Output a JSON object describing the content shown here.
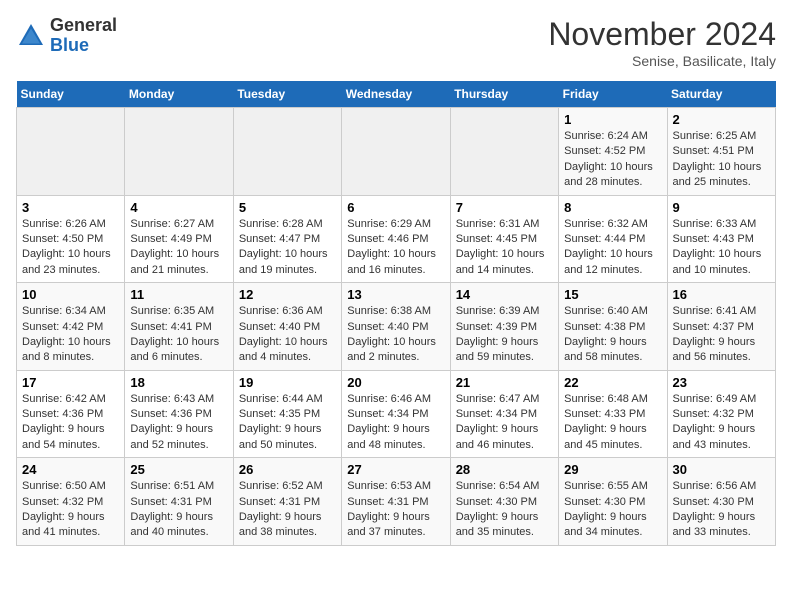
{
  "header": {
    "logo_general": "General",
    "logo_blue": "Blue",
    "month_title": "November 2024",
    "subtitle": "Senise, Basilicate, Italy"
  },
  "weekdays": [
    "Sunday",
    "Monday",
    "Tuesday",
    "Wednesday",
    "Thursday",
    "Friday",
    "Saturday"
  ],
  "weeks": [
    [
      {
        "day": "",
        "info": ""
      },
      {
        "day": "",
        "info": ""
      },
      {
        "day": "",
        "info": ""
      },
      {
        "day": "",
        "info": ""
      },
      {
        "day": "",
        "info": ""
      },
      {
        "day": "1",
        "info": "Sunrise: 6:24 AM\nSunset: 4:52 PM\nDaylight: 10 hours and 28 minutes."
      },
      {
        "day": "2",
        "info": "Sunrise: 6:25 AM\nSunset: 4:51 PM\nDaylight: 10 hours and 25 minutes."
      }
    ],
    [
      {
        "day": "3",
        "info": "Sunrise: 6:26 AM\nSunset: 4:50 PM\nDaylight: 10 hours and 23 minutes."
      },
      {
        "day": "4",
        "info": "Sunrise: 6:27 AM\nSunset: 4:49 PM\nDaylight: 10 hours and 21 minutes."
      },
      {
        "day": "5",
        "info": "Sunrise: 6:28 AM\nSunset: 4:47 PM\nDaylight: 10 hours and 19 minutes."
      },
      {
        "day": "6",
        "info": "Sunrise: 6:29 AM\nSunset: 4:46 PM\nDaylight: 10 hours and 16 minutes."
      },
      {
        "day": "7",
        "info": "Sunrise: 6:31 AM\nSunset: 4:45 PM\nDaylight: 10 hours and 14 minutes."
      },
      {
        "day": "8",
        "info": "Sunrise: 6:32 AM\nSunset: 4:44 PM\nDaylight: 10 hours and 12 minutes."
      },
      {
        "day": "9",
        "info": "Sunrise: 6:33 AM\nSunset: 4:43 PM\nDaylight: 10 hours and 10 minutes."
      }
    ],
    [
      {
        "day": "10",
        "info": "Sunrise: 6:34 AM\nSunset: 4:42 PM\nDaylight: 10 hours and 8 minutes."
      },
      {
        "day": "11",
        "info": "Sunrise: 6:35 AM\nSunset: 4:41 PM\nDaylight: 10 hours and 6 minutes."
      },
      {
        "day": "12",
        "info": "Sunrise: 6:36 AM\nSunset: 4:40 PM\nDaylight: 10 hours and 4 minutes."
      },
      {
        "day": "13",
        "info": "Sunrise: 6:38 AM\nSunset: 4:40 PM\nDaylight: 10 hours and 2 minutes."
      },
      {
        "day": "14",
        "info": "Sunrise: 6:39 AM\nSunset: 4:39 PM\nDaylight: 9 hours and 59 minutes."
      },
      {
        "day": "15",
        "info": "Sunrise: 6:40 AM\nSunset: 4:38 PM\nDaylight: 9 hours and 58 minutes."
      },
      {
        "day": "16",
        "info": "Sunrise: 6:41 AM\nSunset: 4:37 PM\nDaylight: 9 hours and 56 minutes."
      }
    ],
    [
      {
        "day": "17",
        "info": "Sunrise: 6:42 AM\nSunset: 4:36 PM\nDaylight: 9 hours and 54 minutes."
      },
      {
        "day": "18",
        "info": "Sunrise: 6:43 AM\nSunset: 4:36 PM\nDaylight: 9 hours and 52 minutes."
      },
      {
        "day": "19",
        "info": "Sunrise: 6:44 AM\nSunset: 4:35 PM\nDaylight: 9 hours and 50 minutes."
      },
      {
        "day": "20",
        "info": "Sunrise: 6:46 AM\nSunset: 4:34 PM\nDaylight: 9 hours and 48 minutes."
      },
      {
        "day": "21",
        "info": "Sunrise: 6:47 AM\nSunset: 4:34 PM\nDaylight: 9 hours and 46 minutes."
      },
      {
        "day": "22",
        "info": "Sunrise: 6:48 AM\nSunset: 4:33 PM\nDaylight: 9 hours and 45 minutes."
      },
      {
        "day": "23",
        "info": "Sunrise: 6:49 AM\nSunset: 4:32 PM\nDaylight: 9 hours and 43 minutes."
      }
    ],
    [
      {
        "day": "24",
        "info": "Sunrise: 6:50 AM\nSunset: 4:32 PM\nDaylight: 9 hours and 41 minutes."
      },
      {
        "day": "25",
        "info": "Sunrise: 6:51 AM\nSunset: 4:31 PM\nDaylight: 9 hours and 40 minutes."
      },
      {
        "day": "26",
        "info": "Sunrise: 6:52 AM\nSunset: 4:31 PM\nDaylight: 9 hours and 38 minutes."
      },
      {
        "day": "27",
        "info": "Sunrise: 6:53 AM\nSunset: 4:31 PM\nDaylight: 9 hours and 37 minutes."
      },
      {
        "day": "28",
        "info": "Sunrise: 6:54 AM\nSunset: 4:30 PM\nDaylight: 9 hours and 35 minutes."
      },
      {
        "day": "29",
        "info": "Sunrise: 6:55 AM\nSunset: 4:30 PM\nDaylight: 9 hours and 34 minutes."
      },
      {
        "day": "30",
        "info": "Sunrise: 6:56 AM\nSunset: 4:30 PM\nDaylight: 9 hours and 33 minutes."
      }
    ]
  ]
}
